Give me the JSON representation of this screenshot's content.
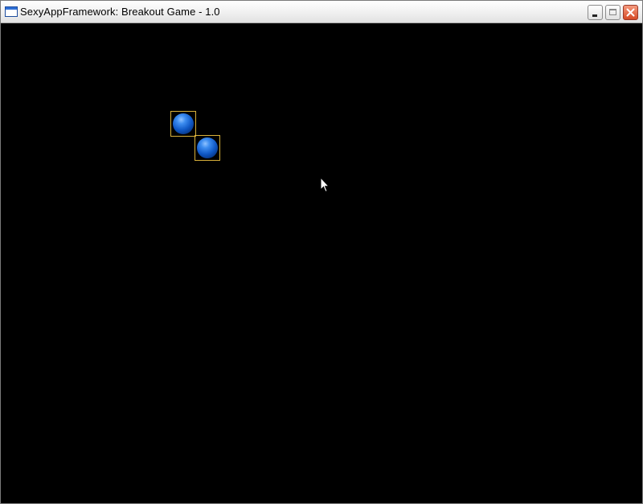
{
  "window": {
    "title": "SexyAppFramework: Breakout Game - 1.0",
    "controls": [
      "minimize",
      "maximize",
      "close"
    ]
  },
  "game": {
    "background_color": "#000000",
    "block_border_color": "#d8b03a",
    "ball_color": "#1464d6",
    "blocks": [
      {
        "name": "block-1",
        "icon": "blue-ball"
      },
      {
        "name": "block-2",
        "icon": "blue-ball"
      }
    ]
  },
  "icons": {
    "app": "window-app-icon",
    "cursor": "mouse-pointer-icon",
    "close": "close-x-icon"
  }
}
